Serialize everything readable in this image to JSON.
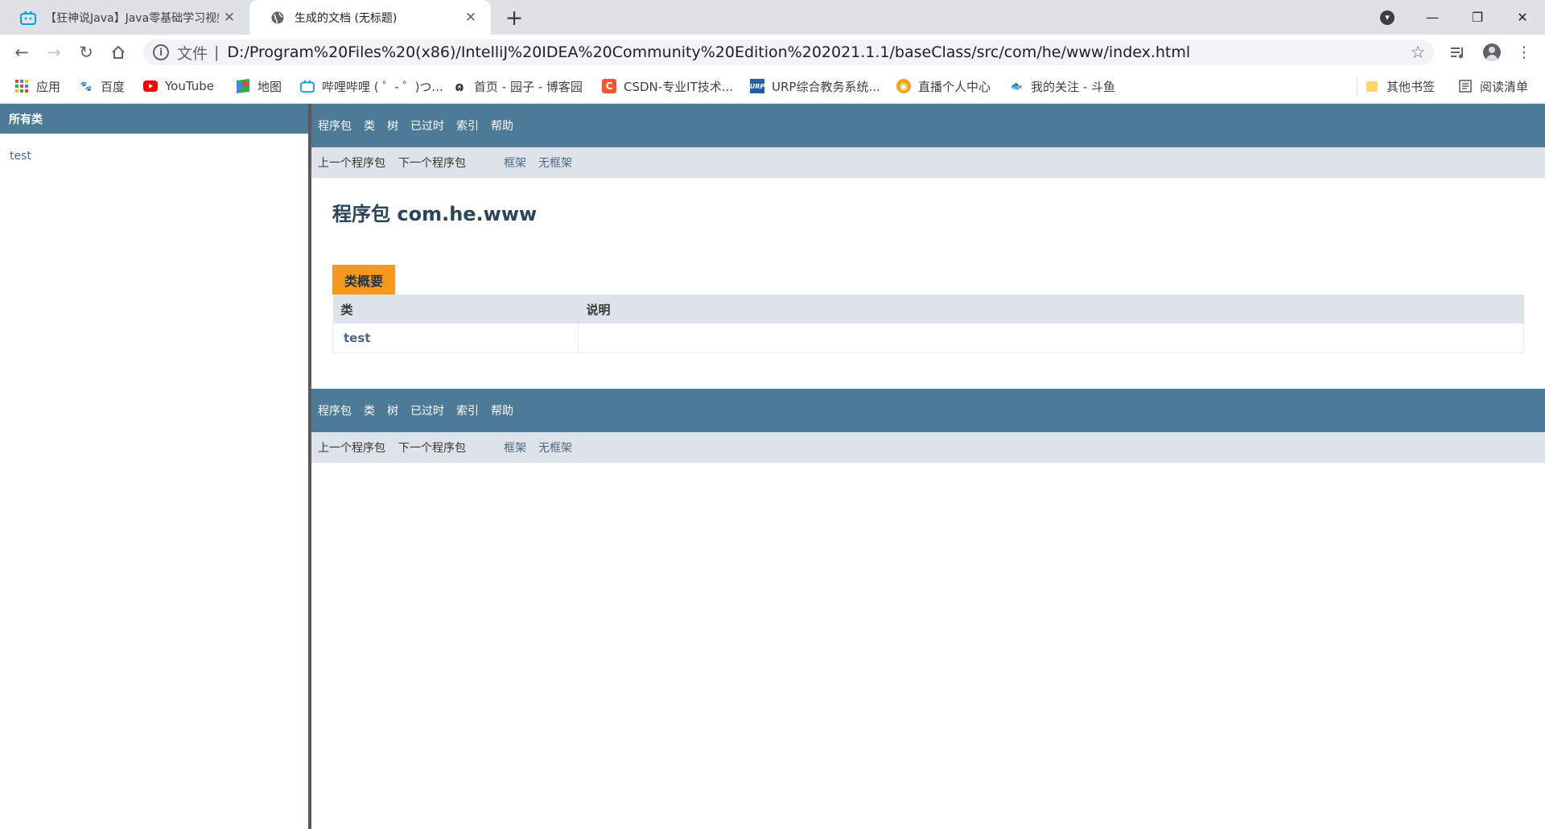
{
  "browser": {
    "tabs": [
      {
        "title": "【狂神说Java】Java零基础学习视频通俗易懂",
        "active": false
      },
      {
        "title": "生成的文档 (无标题)",
        "active": true
      }
    ],
    "address": {
      "scheme_label": "文件",
      "separator": "|",
      "url": "D:/Program%20Files%20(x86)/IntelliJ%20IDEA%20Community%20Edition%202021.1.1/baseClass/src/com/he/www/index.html"
    },
    "bookmarks": [
      {
        "label": "应用",
        "icon": "apps-grid-icon"
      },
      {
        "label": "百度",
        "icon": "baidu-icon"
      },
      {
        "label": "YouTube",
        "icon": "youtube-icon"
      },
      {
        "label": "地图",
        "icon": "maps-icon"
      },
      {
        "label": "哔哩哔哩 ( ゜- ゜)つ...",
        "icon": "bilibili-icon"
      },
      {
        "label": "首页 - 园子 - 博客园",
        "icon": "cnblogs-icon"
      },
      {
        "label": "CSDN-专业IT技术...",
        "icon": "csdn-icon"
      },
      {
        "label": "URP综合教务系统...",
        "icon": "urp-icon"
      },
      {
        "label": "直播个人中心",
        "icon": "live-icon"
      },
      {
        "label": "我的关注 - 斗鱼",
        "icon": "douyu-icon"
      }
    ],
    "other_bookmarks": "其他书签",
    "reading_list": "阅读清单",
    "colors": {
      "tabstrip": "#dee1e6",
      "omnibox": "#f1f3f4"
    }
  },
  "left_frame": {
    "header": "所有类",
    "classes": [
      "test"
    ]
  },
  "right_frame": {
    "nav": {
      "items": [
        "程序包",
        "类",
        "树",
        "已过时",
        "索引",
        "帮助"
      ],
      "prev": "上一个程序包",
      "next": "下一个程序包",
      "frames": "框架",
      "no_frames": "无框架"
    },
    "package_title": "程序包 com.he.www",
    "summary": {
      "caption": "类概要",
      "columns": [
        "类",
        "说明"
      ],
      "rows": [
        {
          "class": "test",
          "description": ""
        }
      ]
    },
    "colors": {
      "nav": "#4d7a97",
      "subnav": "#dee3e9",
      "caption": "#f8981d"
    }
  }
}
